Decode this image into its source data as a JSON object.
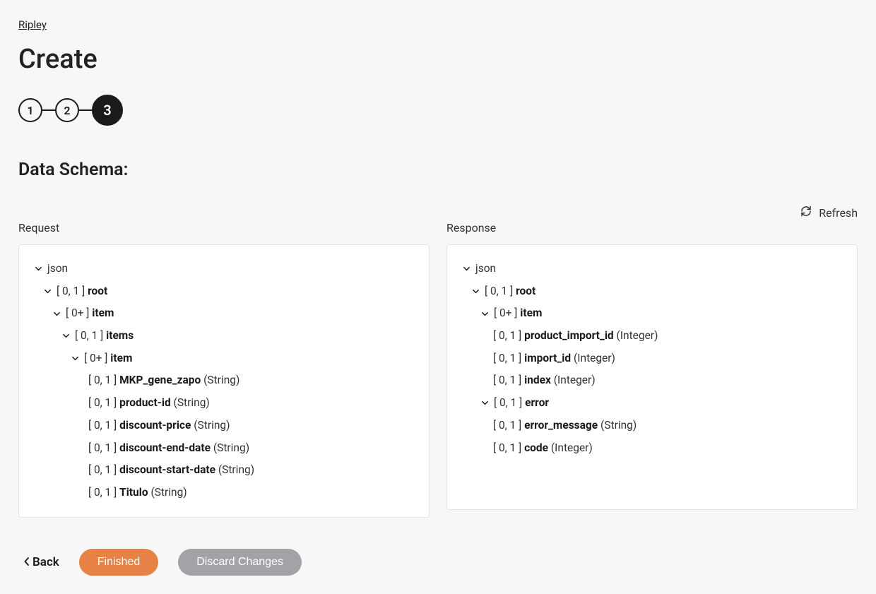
{
  "breadcrumb": "Ripley",
  "page_title": "Create",
  "steps": [
    "1",
    "2",
    "3"
  ],
  "section_title": "Data Schema:",
  "refresh_label": "Refresh",
  "request_label": "Request",
  "response_label": "Response",
  "request_tree": [
    {
      "indent": 0,
      "caret": true,
      "card": "",
      "name": "json",
      "type": ""
    },
    {
      "indent": 1,
      "caret": true,
      "card": "[ 0, 1 ]",
      "name": "root",
      "type": ""
    },
    {
      "indent": 2,
      "caret": true,
      "card": "[ 0+ ]",
      "name": "item",
      "type": ""
    },
    {
      "indent": 3,
      "caret": true,
      "card": "[ 0, 1 ]",
      "name": "items",
      "type": ""
    },
    {
      "indent": 4,
      "caret": true,
      "card": "[ 0+ ]",
      "name": "item",
      "type": ""
    },
    {
      "indent": 5,
      "caret": false,
      "card": "[ 0, 1 ]",
      "name": "MKP_gene_zapo",
      "type": "(String)"
    },
    {
      "indent": 5,
      "caret": false,
      "card": "[ 0, 1 ]",
      "name": "product-id",
      "type": "(String)"
    },
    {
      "indent": 5,
      "caret": false,
      "card": "[ 0, 1 ]",
      "name": "discount-price",
      "type": "(String)"
    },
    {
      "indent": 5,
      "caret": false,
      "card": "[ 0, 1 ]",
      "name": "discount-end-date",
      "type": "(String)"
    },
    {
      "indent": 5,
      "caret": false,
      "card": "[ 0, 1 ]",
      "name": "discount-start-date",
      "type": "(String)"
    },
    {
      "indent": 5,
      "caret": false,
      "card": "[ 0, 1 ]",
      "name": "Titulo",
      "type": "(String)"
    }
  ],
  "response_tree": [
    {
      "indent": 0,
      "caret": true,
      "card": "",
      "name": "json",
      "type": ""
    },
    {
      "indent": 1,
      "caret": true,
      "card": "[ 0, 1 ]",
      "name": "root",
      "type": ""
    },
    {
      "indent": 2,
      "caret": true,
      "card": "[ 0+ ]",
      "name": "item",
      "type": ""
    },
    {
      "indent": 3,
      "caret": false,
      "card": "[ 0, 1 ]",
      "name": "product_import_id",
      "type": "(Integer)"
    },
    {
      "indent": 3,
      "caret": false,
      "card": "[ 0, 1 ]",
      "name": "import_id",
      "type": "(Integer)"
    },
    {
      "indent": 3,
      "caret": false,
      "card": "[ 0, 1 ]",
      "name": "index",
      "type": "(Integer)"
    },
    {
      "indent": 2,
      "caret": true,
      "card": "[ 0, 1 ]",
      "name": "error",
      "type": ""
    },
    {
      "indent": 3,
      "caret": false,
      "card": "[ 0, 1 ]",
      "name": "error_message",
      "type": "(String)"
    },
    {
      "indent": 3,
      "caret": false,
      "card": "[ 0, 1 ]",
      "name": "code",
      "type": "(Integer)"
    }
  ],
  "buttons": {
    "back": "Back",
    "finished": "Finished",
    "discard": "Discard Changes"
  }
}
